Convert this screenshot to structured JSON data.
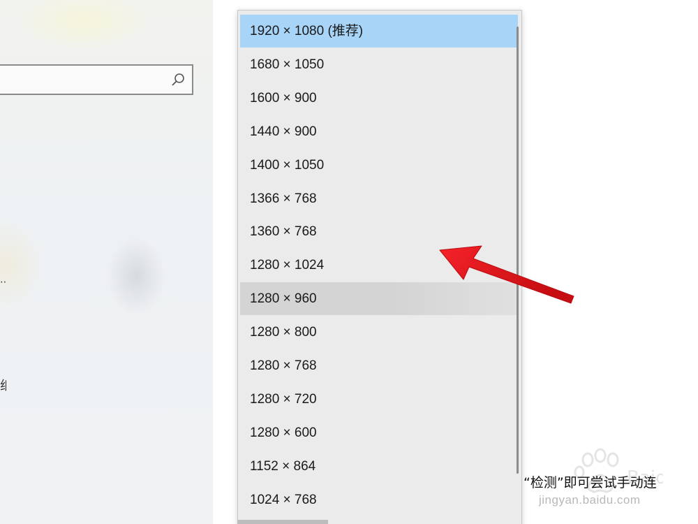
{
  "left_panel": {
    "cut_text_1": "⋯",
    "cut_text_2": "纸"
  },
  "dropdown": {
    "options": [
      {
        "label": "1920 × 1080 (推荐)",
        "state": "selected"
      },
      {
        "label": "1680 × 1050",
        "state": "normal"
      },
      {
        "label": "1600 × 900",
        "state": "normal"
      },
      {
        "label": "1440 × 900",
        "state": "normal"
      },
      {
        "label": "1400 × 1050",
        "state": "normal"
      },
      {
        "label": "1366 × 768",
        "state": "normal"
      },
      {
        "label": "1360 × 768",
        "state": "normal"
      },
      {
        "label": "1280 × 1024",
        "state": "normal"
      },
      {
        "label": "1280 × 960",
        "state": "hovered"
      },
      {
        "label": "1280 × 800",
        "state": "normal"
      },
      {
        "label": "1280 × 768",
        "state": "normal"
      },
      {
        "label": "1280 × 720",
        "state": "normal"
      },
      {
        "label": "1280 × 600",
        "state": "normal"
      },
      {
        "label": "1152 × 864",
        "state": "normal"
      },
      {
        "label": "1024 × 768",
        "state": "normal"
      }
    ]
  },
  "side_text": "“检测”即可尝试手动连",
  "watermark": {
    "brand": "Baidu 经验",
    "url": "jingyan.baidu.com"
  },
  "colors": {
    "selected_bg": "#a8d4f7",
    "arrow": "#e8141b"
  },
  "icons": {
    "search": "search-icon",
    "annotation": "red-arrow-icon"
  }
}
